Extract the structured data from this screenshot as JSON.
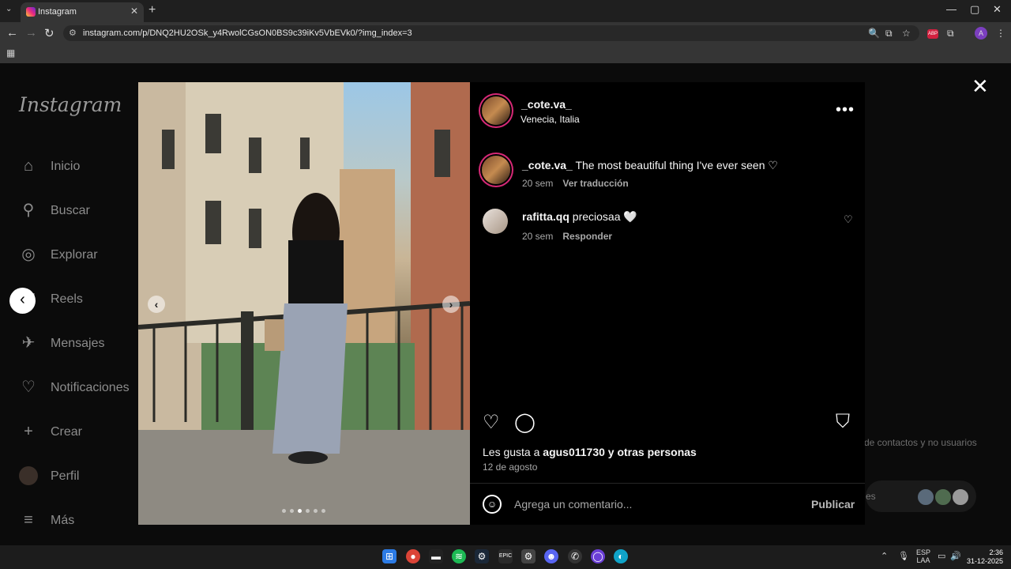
{
  "browser": {
    "tab_title": "Instagram",
    "tab_close": "✕",
    "new_tab": "+",
    "url": "instagram.com/p/DNQ2HU2OSk_y4RwolCGsON0BS9c39iKv5VbEVk0/?img_index=3",
    "window_controls": [
      "—",
      "▢",
      "✕"
    ],
    "profile_initial": "A",
    "extension_badge": "ABP"
  },
  "sidebar": {
    "logo": "Instagram",
    "items": [
      {
        "label": "Inicio",
        "icon": "home-icon"
      },
      {
        "label": "Buscar",
        "icon": "search-icon"
      },
      {
        "label": "Explorar",
        "icon": "compass-icon"
      },
      {
        "label": "Reels",
        "icon": "reels-icon"
      },
      {
        "label": "Mensajes",
        "icon": "messages-icon"
      },
      {
        "label": "Notificaciones",
        "icon": "heart-icon"
      },
      {
        "label": "Crear",
        "icon": "plus-icon"
      },
      {
        "label": "Perfil",
        "icon": "avatar-icon"
      },
      {
        "label": "Más",
        "icon": "menu-icon"
      }
    ]
  },
  "background": {
    "suggestion_text": "de contactos y no usuarios",
    "messages_pill": "es"
  },
  "post": {
    "username": "_cote.va_",
    "location": "Venecia, Italia",
    "caption": "The most beautiful thing I've ever seen ♡",
    "caption_age": "20 sem",
    "translate_link": "Ver traducción",
    "comment": {
      "username": "rafitta.qq",
      "text": "preciosaa 🤍",
      "age": "20 sem",
      "reply_link": "Responder"
    },
    "likes_prefix": "Les gusta a",
    "likes_user": "agus011730",
    "likes_suffix": "y otras personas",
    "date": "12 de agosto",
    "comment_placeholder": "Agrega un comentario...",
    "publish_label": "Publicar",
    "carousel": {
      "count": 6,
      "active_index": 2
    }
  },
  "taskbar": {
    "lang_top": "ESP",
    "lang_bottom": "LAA",
    "time": "2:36",
    "date": "31-12-2025"
  },
  "colors": {
    "accent_ring": "#d62976",
    "panel_bg": "#000000",
    "secondary_text": "#a8a8a8"
  }
}
